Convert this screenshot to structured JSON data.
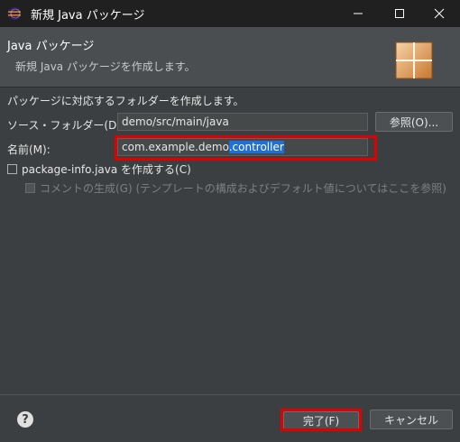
{
  "window": {
    "title": "新規 Java パッケージ"
  },
  "header": {
    "title": "Java パッケージ",
    "description": "新規 Java パッケージを作成します。"
  },
  "body": {
    "description": "パッケージに対応するフォルダーを作成します。",
    "source_folder": {
      "label": "ソース・フォルダー(D):",
      "value": "demo/src/main/java",
      "browse_label": "参照(O)..."
    },
    "name": {
      "label": "名前(M):",
      "value_prefix": "com.example.demo",
      "value_selected": ".controller"
    },
    "create_package_info": {
      "label": "package-info.java を作成する(C)",
      "checked": false
    },
    "generate_comment": {
      "label": "コメントの生成(G) (テンプレートの構成およびデフォルト値についてはここを参照)",
      "checked": false,
      "enabled": false
    }
  },
  "footer": {
    "help_glyph": "?",
    "finish_label": "完了(F)",
    "cancel_label": "キャンセル"
  },
  "colors": {
    "background": "#3c3f41",
    "titlebar": "#202020",
    "selection": "#1f6fd6",
    "highlight": "#e00000"
  }
}
